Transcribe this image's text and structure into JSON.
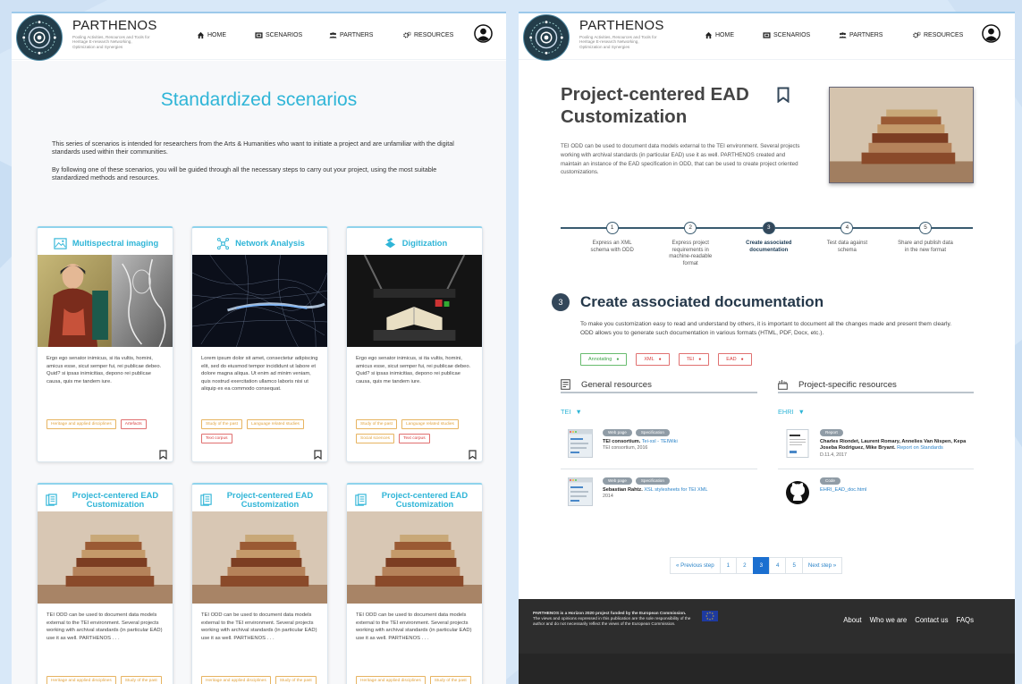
{
  "brand": {
    "name": "PARTHENOS",
    "tagline": "Pooling Activities, Resources and Tools for Heritage E-research Networking, Optimization and Synergies"
  },
  "nav": {
    "home": "HOME",
    "scenarios": "SCENARIOS",
    "partners": "PARTNERS",
    "resources": "RESOURCES"
  },
  "left": {
    "title": "Standardized scenarios",
    "intro1": "This series of scenarios is intended for researchers from the Arts & Humanities who want to initiate a project and are unfamiliar with the digital standards used within their communities.",
    "intro2": "By following one of these scenarios, you will be guided through all the necessary steps to carry out your project, using the most suitable standardized methods and resources.",
    "cards": [
      {
        "title": "Multispectral imaging",
        "text": "Ergo ego senator inimicus, si ita vultis, homini, amicus esse, sicut semper fui, rei publicae debeo. Quid? si ipsas inimicitias, depono rei publicae causa, quis me tandem iure.",
        "tags": [
          {
            "t": "Heritage and applied disciplines",
            "c": "o"
          },
          {
            "t": "Artefacts",
            "c": "r"
          }
        ]
      },
      {
        "title": "Network Analysis",
        "text": "Lorem ipsum dolor sit amet, consectetur adipiscing elit, sed do eiusmod tempor incididunt ut labore et dolore magna aliqua. Ut enim ad minim veniam, quis nostrud exercitation ullamco laboris nisi ut aliquip ex ea commodo consequat.",
        "tags": [
          {
            "t": "Study of the past",
            "c": "o"
          },
          {
            "t": "Language related studies",
            "c": "o"
          },
          {
            "t": "Text corpus",
            "c": "r"
          }
        ]
      },
      {
        "title": "Digitization",
        "text": "Ergo ego senator inimicus, si ita vultis, homini, amicus esse, sicut semper fui, rei publicae debeo. Quid? si ipsas inimicitias, depono rei publicae causa, quis me tandem iure.",
        "tags": [
          {
            "t": "Study of the past",
            "c": "o"
          },
          {
            "t": "Language related studies",
            "c": "o"
          },
          {
            "t": "Social sciences",
            "c": "o"
          },
          {
            "t": "Text corpus",
            "c": "r"
          }
        ]
      },
      {
        "title": "Project-centered EAD Customization",
        "text": "TEI ODD can be used to document data models external to the TEI environment. Several projects working with archival standards (in particular EAD) use it as well. PARTHENOS . . .",
        "tags": [
          {
            "t": "Heritage and applied disciplines",
            "c": "o"
          },
          {
            "t": "Study of the past",
            "c": "o"
          }
        ]
      },
      {
        "title": "Project-centered EAD Customization",
        "text": "TEI ODD can be used to document data models external to the TEI environment. Several projects working with archival standards (in particular EAD) use it as well. PARTHENOS . . .",
        "tags": [
          {
            "t": "Heritage and applied disciplines",
            "c": "o"
          },
          {
            "t": "Study of the past",
            "c": "o"
          }
        ]
      },
      {
        "title": "Project-centered EAD Customization",
        "text": "TEI ODD can be used to document data models external to the TEI environment. Several projects working with archival standards (in particular EAD) use it as well. PARTHENOS . . .",
        "tags": [
          {
            "t": "Heritage and applied disciplines",
            "c": "o"
          },
          {
            "t": "Study of the past",
            "c": "o"
          }
        ]
      }
    ]
  },
  "right": {
    "title": "Project-centered EAD Customization",
    "description": "TEI ODD can be used to document data models external to the TEI environment. Several projects working with archival standards (in particular EAD) use it as well. PARTHENOS created and maintain an instance of the EAD specification in ODD, that can be used to create project oriented customizations.",
    "steps": [
      {
        "n": "1",
        "label": "Express an XML schema with ODD"
      },
      {
        "n": "2",
        "label": "Express project requirements in machine-readable format"
      },
      {
        "n": "3",
        "label": "Create associated documentation"
      },
      {
        "n": "4",
        "label": "Test data against schema"
      },
      {
        "n": "5",
        "label": "Share and publish data in the new format"
      }
    ],
    "active_step": 3,
    "section": {
      "number": "3",
      "title": "Create associated documentation",
      "description": "To make you customization easy to read and understand by others, it is important to document all the changes made and present them clearly. ODD allows you to generate such documentation in various formats (HTML, PDF, Docx, etc.).",
      "tags": [
        {
          "t": "Annotating",
          "c": "g"
        },
        {
          "t": "XML",
          "c": "r"
        },
        {
          "t": "TEI",
          "c": "r"
        },
        {
          "t": "EAD",
          "c": "r"
        }
      ]
    },
    "general": {
      "heading": "General resources",
      "filter": "TEI",
      "entries": [
        {
          "pills": [
            "Web page",
            "Specification"
          ],
          "author": "TEI consortium.",
          "link": "Tei-xsl - TEIWiki",
          "sub": "TEI consortium, 2016"
        },
        {
          "pills": [
            "Web page",
            "Specification"
          ],
          "author": "Sebastian Rahtz.",
          "link": "XSL stylesheets for TEI XML",
          "sub": "2014"
        }
      ]
    },
    "specific": {
      "heading": "Project-specific resources",
      "filter": "EHRI",
      "entries": [
        {
          "pills": [
            "Report"
          ],
          "author": "Charles Riondet, Laurent Romary, Annelies Van Nispen, Kepa Joseba Rodriguez, Mike Bryant.",
          "link": "Report on Standards",
          "sub": "D.11.4, 2017"
        },
        {
          "pills": [
            "Code"
          ],
          "author": "",
          "link": "EHRI_EAD_doc.html",
          "sub": ""
        }
      ]
    },
    "pagination": {
      "prev": "« Previous step",
      "pages": [
        "1",
        "2",
        "3",
        "4",
        "5"
      ],
      "current": "3",
      "next": "Next step »"
    },
    "footer": {
      "text_bold": "PARTHENOS is a Horizon 2020 project funded by the European Commission.",
      "text": "The views and opinions expressed in this publication are the sole responsibility of the author and do not necessarily reflect the views of the European Commission.",
      "links": [
        "About",
        "Who we are",
        "Contact us",
        "FAQs"
      ]
    }
  },
  "colors": {
    "accent": "#2fb5d7",
    "dark": "#33475a",
    "link": "#2a83c8",
    "tag_orange": "#e1a33f",
    "tag_red": "#d83c3c",
    "tag_green": "#3fa54a",
    "footer": "#2d2d2d"
  },
  "icons": [
    "home-icon",
    "scenarios-icon",
    "partners-icon",
    "resources-icon",
    "user-icon",
    "bookmark-icon",
    "multispectral-icon",
    "network-icon",
    "digitization-icon",
    "book-icon",
    "document-list-icon",
    "toolbox-icon",
    "github-icon",
    "eu-flag-icon",
    "caret-down-icon"
  ]
}
